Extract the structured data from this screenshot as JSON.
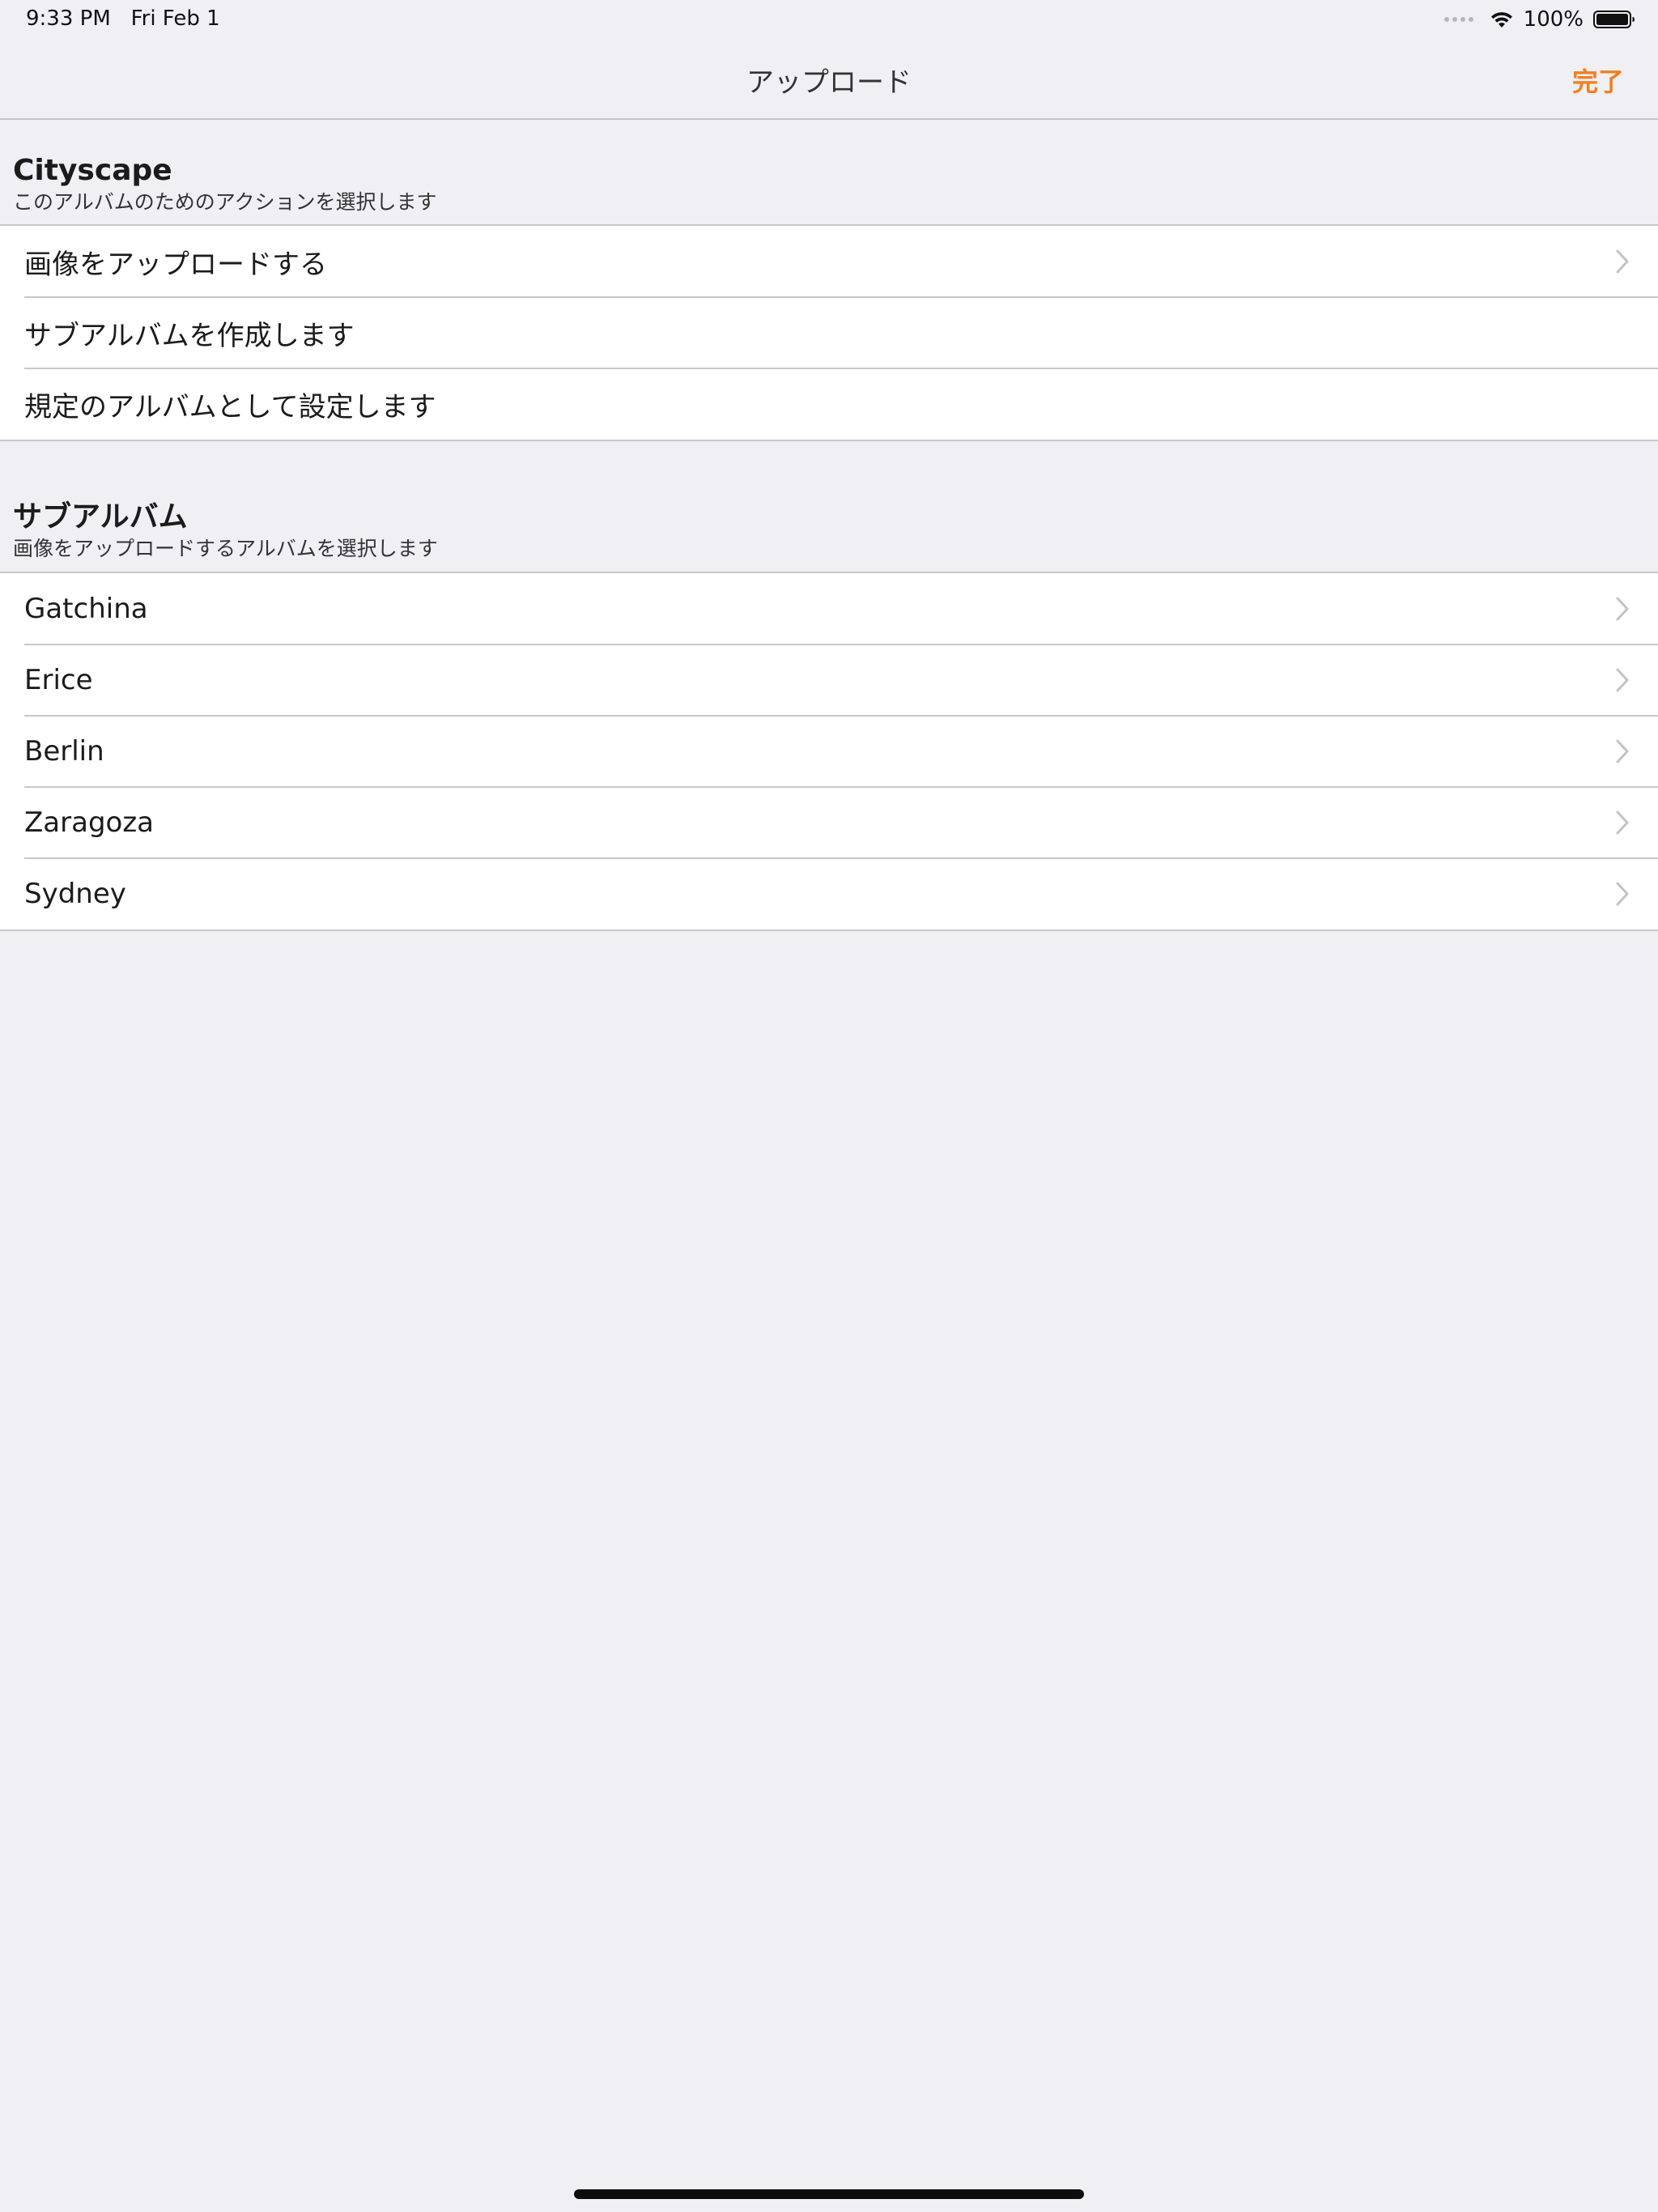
{
  "status_bar": {
    "time": "9:33 PM",
    "date": "Fri Feb 1",
    "battery": "100%"
  },
  "nav": {
    "title": "アップロード",
    "done_label": "完了",
    "accent_color": "#f17f1e"
  },
  "actions_section": {
    "title": "Cityscape",
    "subtitle": "このアルバムのためのアクションを選択します",
    "items": [
      {
        "label": "画像をアップロードする",
        "chevron": true
      },
      {
        "label": "サブアルバムを作成します",
        "chevron": false
      },
      {
        "label": "規定のアルバムとして設定します",
        "chevron": false
      }
    ]
  },
  "subalbums_section": {
    "title": "サブアルバム",
    "subtitle": "画像をアップロードするアルバムを選択します",
    "items": [
      {
        "label": "Gatchina",
        "chevron": true
      },
      {
        "label": "Erice",
        "chevron": true
      },
      {
        "label": "Berlin",
        "chevron": true
      },
      {
        "label": "Zaragoza",
        "chevron": true
      },
      {
        "label": "Sydney",
        "chevron": true
      }
    ]
  },
  "icons": {
    "wifi": "wifi-icon",
    "battery": "battery-icon",
    "chevron": "chevron-right-icon",
    "signal": "signal-dots-icon"
  }
}
